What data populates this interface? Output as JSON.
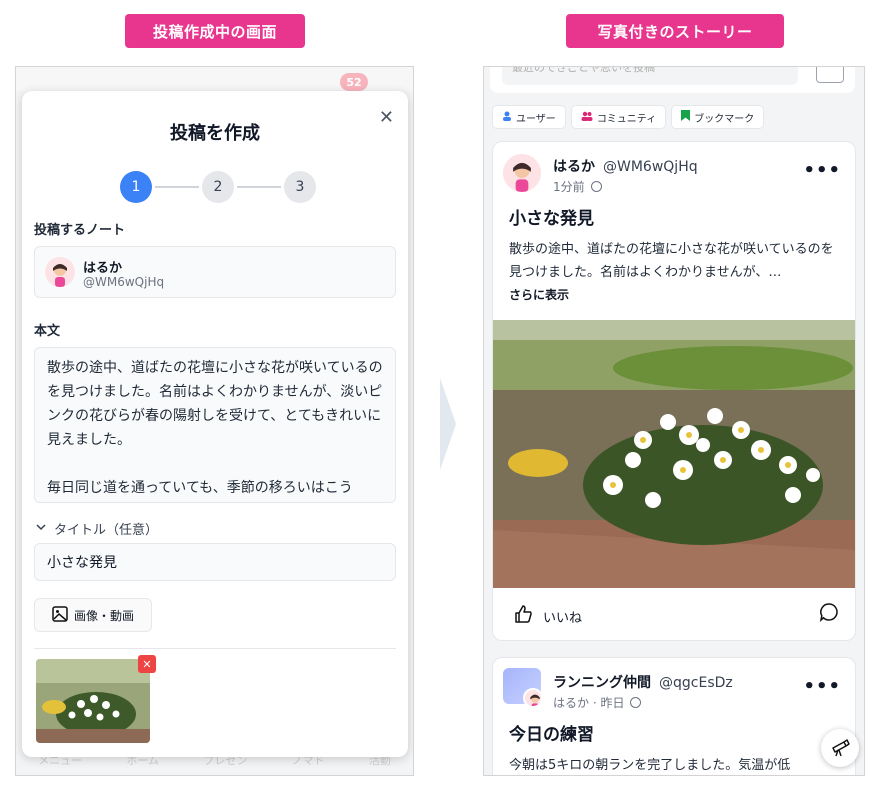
{
  "labels": {
    "left_caption": "投稿作成中の画面",
    "right_caption": "写真付きのストーリー"
  },
  "colors": {
    "caption_bg": "#e8368f",
    "accent": "#3b82f6",
    "delete": "#ef4444"
  },
  "left": {
    "bg_badge": "52",
    "bg_tabs": [
      "メニュー",
      "ホーム",
      "プレゼン",
      "ノマド",
      "活動"
    ],
    "modal": {
      "title": "投稿を作成",
      "close_icon": "close-icon",
      "steps": [
        "1",
        "2",
        "3"
      ],
      "active_step": 1,
      "note_label": "投稿するノート",
      "note": {
        "name": "はるか",
        "handle": "@WM6wQjHq"
      },
      "body_label": "本文",
      "body_text": "散歩の途中、道ばたの花壇に小さな花が咲いているのを見つけました。名前はよくわかりませんが、淡いピンクの花びらが春の陽射しを受けて、とてもきれいに見えました。\n\n毎日同じ道を通っていても、季節の移ろいはこう",
      "title_toggle": "タイトル（任意）",
      "title_value": "小さな発見",
      "media_button": "画像・動画"
    }
  },
  "right": {
    "search_placeholder": "最近のできごとや思いを投稿",
    "chips": [
      {
        "label": "ユーザー",
        "icon": "user-icon",
        "color": "#3b82f6"
      },
      {
        "label": "コミュニティ",
        "icon": "users-icon",
        "color": "#db2777"
      },
      {
        "label": "ブックマーク",
        "icon": "bookmark-icon",
        "color": "#16a34a"
      }
    ],
    "post1": {
      "name": "はるか",
      "handle": "@WM6wQjHq",
      "time": "1分前",
      "title": "小さな発見",
      "body": "散歩の途中、道ばたの花壇に小さな花が咲いているのを見つけました。名前はよくわかりませんが、…",
      "read_more": "さらに表示",
      "like_label": "いいね"
    },
    "post2": {
      "community": "ランニング仲間",
      "handle": "@qgcEsDz",
      "sub": "はるか · 昨日",
      "title": "今日の練習",
      "body": "今朝は5キロの朝ランを完了しました。気温が低"
    }
  }
}
